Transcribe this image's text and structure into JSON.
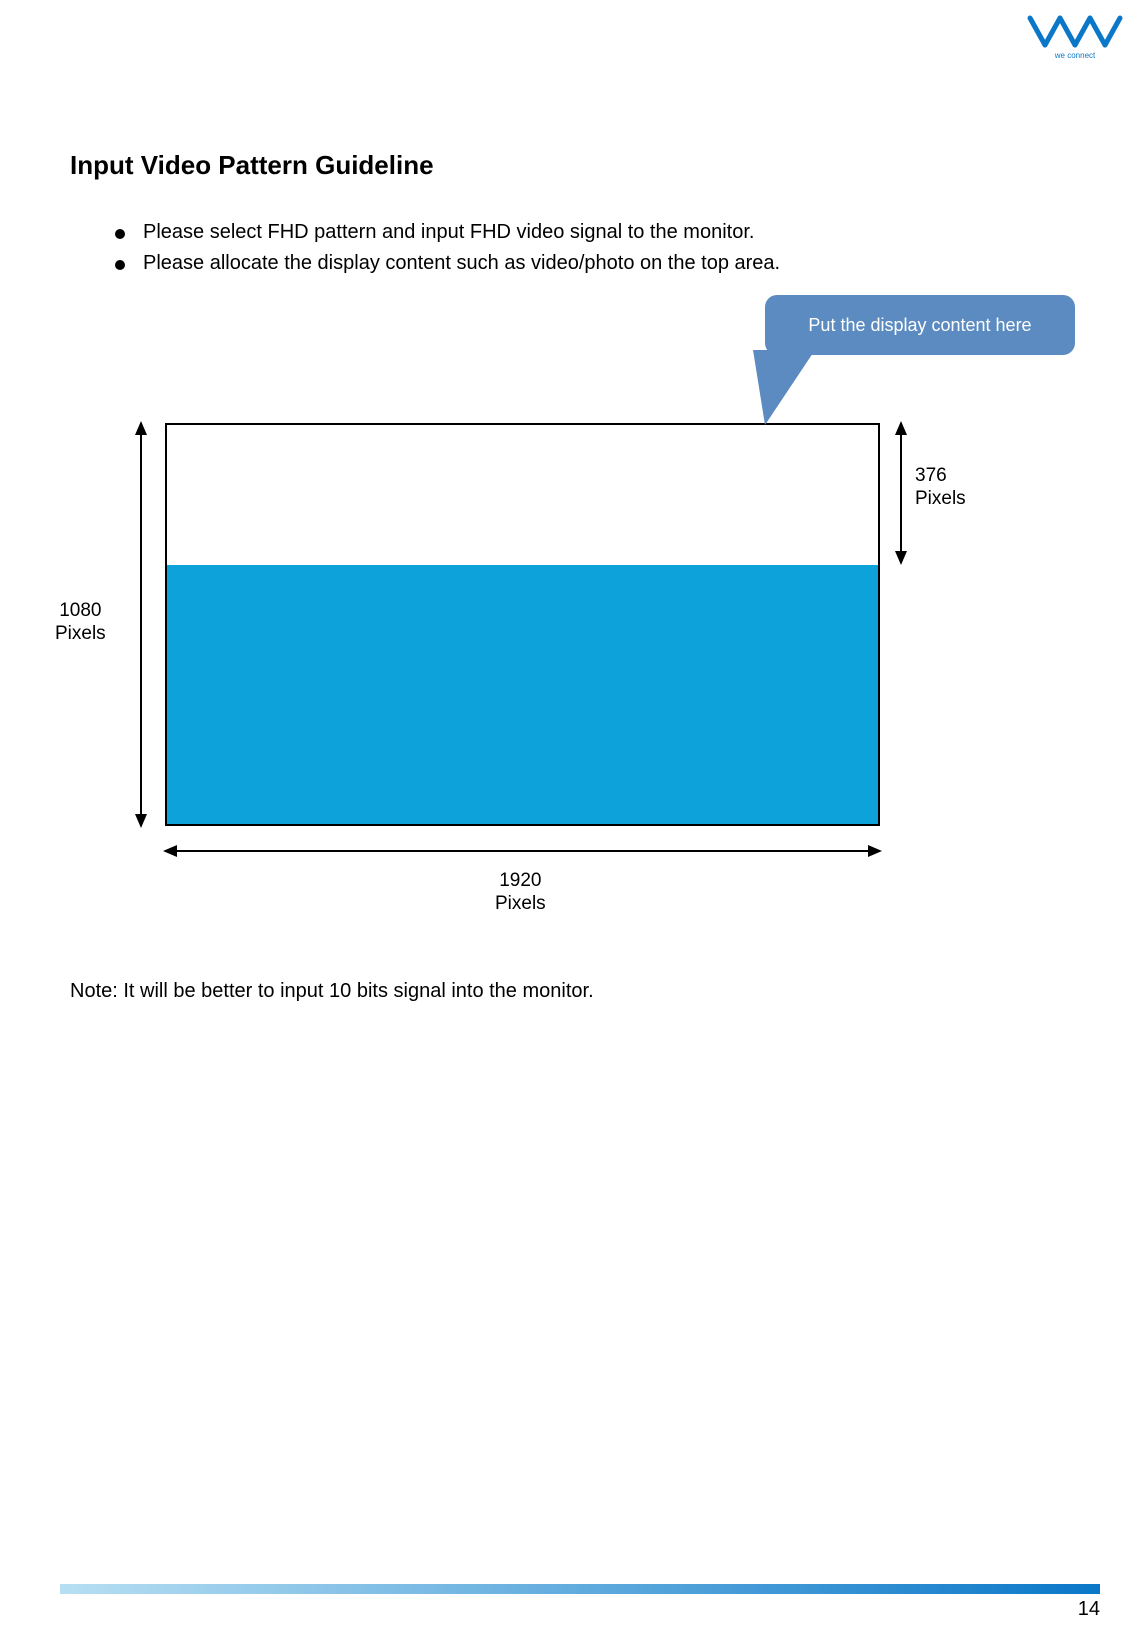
{
  "logo": {
    "tagline": "we connect"
  },
  "heading": "Input Video Pattern Guideline",
  "bullets": [
    "Please select FHD pattern and input FHD video signal to the monitor.",
    "Please allocate the display content such as video/photo on the top area."
  ],
  "diagram": {
    "callout": "Put the display content here",
    "height_label_value": "1080",
    "height_label_unit": "Pixels",
    "top_height_value": "376",
    "top_height_unit": "Pixels",
    "width_label_value": "1920",
    "width_label_unit": "Pixels"
  },
  "note": "Note: It will be better to input 10 bits signal into the monitor.",
  "page_number": "14"
}
